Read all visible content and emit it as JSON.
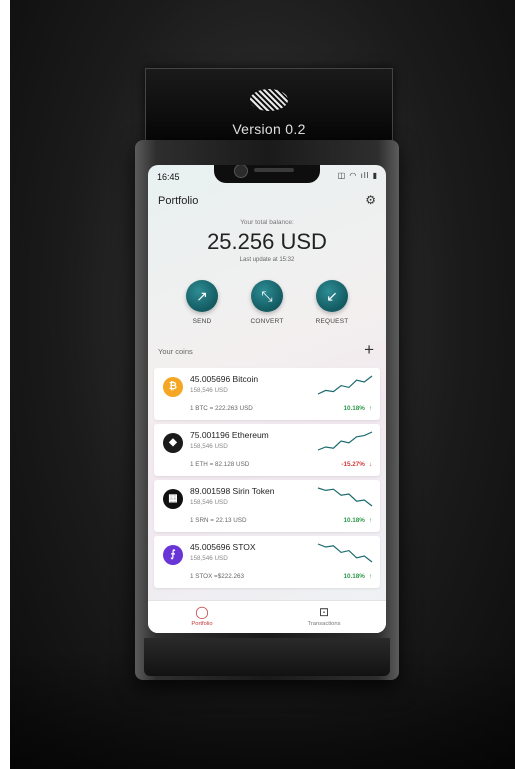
{
  "device": {
    "version_label": "Version 0.2"
  },
  "status": {
    "time": "16:45",
    "icons": "◫ ◠ ıll ▮"
  },
  "header": {
    "title": "Portfolio",
    "settings_icon": "gear-icon"
  },
  "balance": {
    "label": "Your total balance:",
    "value": "25.256 USD",
    "update": "Last update at 15:32"
  },
  "actions": [
    {
      "label": "SEND",
      "icon": "arrow-up-right-icon",
      "glyph": "↗"
    },
    {
      "label": "CONVERT",
      "icon": "convert-icon",
      "glyph": "⤡"
    },
    {
      "label": "REQUEST",
      "icon": "arrow-down-left-icon",
      "glyph": "↙"
    }
  ],
  "coins_section": {
    "title": "Your coins",
    "add_icon": "plus-icon"
  },
  "coins": [
    {
      "name": "45.005696 Bitcoin",
      "usd": "158,546 USD",
      "rate": "1 BTC = 222.263 USD",
      "change": "10.18%",
      "direction": "up",
      "arrow": "↑",
      "icon": "bitcoin-icon",
      "glyph": "₿",
      "icon_color": "#f5a623",
      "spark": [
        1,
        1.6,
        1.4,
        2.4,
        2.1,
        3.3,
        3.0,
        4.0
      ]
    },
    {
      "name": "75.001196 Ethereum",
      "usd": "158,546 USD",
      "rate": "1 ETH = 82.128 USD",
      "change": "-15.27%",
      "direction": "down",
      "arrow": "↓",
      "icon": "ethereum-icon",
      "glyph": "◆",
      "icon_color": "#1b1b1b",
      "spark": [
        1,
        1.5,
        1.3,
        2.5,
        2.2,
        3.2,
        3.4,
        4.0
      ]
    },
    {
      "name": "89.001598 Sirin Token",
      "usd": "158,546 USD",
      "rate": "1 SRN = 22.13 USD",
      "change": "10.18%",
      "direction": "up",
      "arrow": "↑",
      "icon": "sirin-token-icon",
      "glyph": "▦",
      "icon_color": "#111111",
      "spark": [
        4.0,
        3.6,
        3.8,
        2.8,
        3.0,
        1.8,
        2.0,
        1.0
      ]
    },
    {
      "name": "45.005696 STOX",
      "usd": "158,546 USD",
      "rate": "1 STOX =$222.263",
      "change": "10.18%",
      "direction": "up",
      "arrow": "↑",
      "icon": "stox-icon",
      "glyph": "⨍",
      "icon_color": "#6a35d6",
      "spark": [
        4.0,
        3.5,
        3.7,
        2.6,
        2.9,
        1.7,
        2.0,
        1.0
      ]
    }
  ],
  "tabs": [
    {
      "label": "Portfolio",
      "icon": "portfolio-icon",
      "glyph": "◯",
      "active": true
    },
    {
      "label": "Transactions",
      "icon": "wallet-icon",
      "glyph": "⊡",
      "active": false
    }
  ],
  "colors": {
    "up": "#2e9a4a",
    "down": "#d43838",
    "accent": "#1b6a70"
  }
}
